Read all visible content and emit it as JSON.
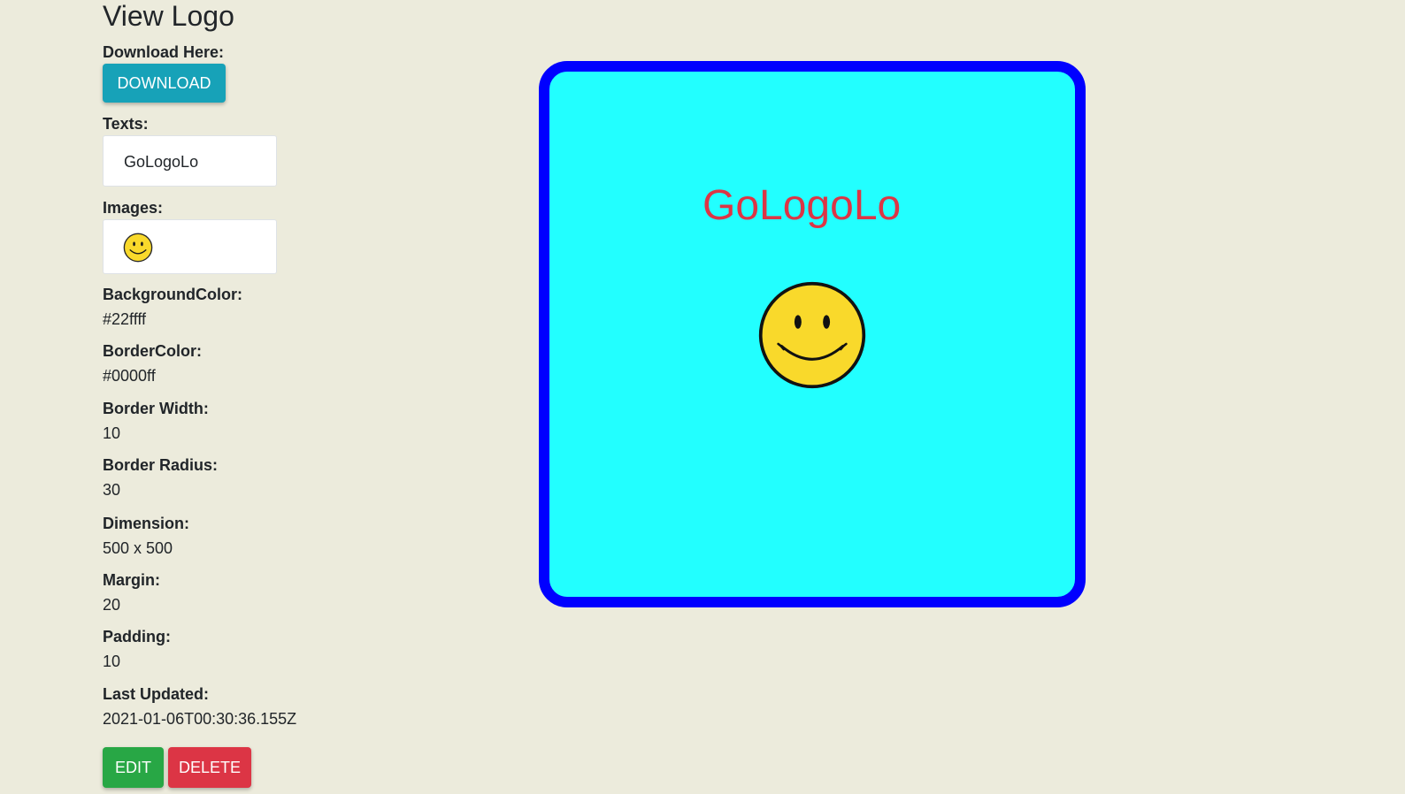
{
  "page": {
    "title": "View Logo"
  },
  "download": {
    "label": "Download Here:",
    "button_label": "DOWNLOAD"
  },
  "texts": {
    "label": "Texts:",
    "items": [
      "GoLogoLo"
    ]
  },
  "images": {
    "label": "Images:",
    "items": [
      "smiley-face-icon"
    ]
  },
  "properties": {
    "background_color": {
      "label": "BackgroundColor:",
      "value": "#22ffff"
    },
    "border_color": {
      "label": "BorderColor:",
      "value": "#0000ff"
    },
    "border_width": {
      "label": "Border Width:",
      "value": "10"
    },
    "border_radius": {
      "label": "Border Radius:",
      "value": "30"
    },
    "dimension": {
      "label": "Dimension:",
      "value": "500 x 500"
    },
    "margin": {
      "label": "Margin:",
      "value": "20"
    },
    "padding": {
      "label": "Padding:",
      "value": "10"
    },
    "last_updated": {
      "label": "Last Updated:",
      "value": "2021-01-06T00:30:36.155Z"
    }
  },
  "actions": {
    "edit_label": "EDIT",
    "delete_label": "DELETE"
  },
  "preview": {
    "text": "GoLogoLo",
    "text_color": "#dc3545",
    "background_color": "#22ffff",
    "border_color": "#0000ff",
    "image_icon": "smiley-face-icon"
  },
  "colors": {
    "page_background": "#ecebdc",
    "download_button": "#17a2b8",
    "edit_button": "#28a745",
    "delete_button": "#dc3545"
  }
}
